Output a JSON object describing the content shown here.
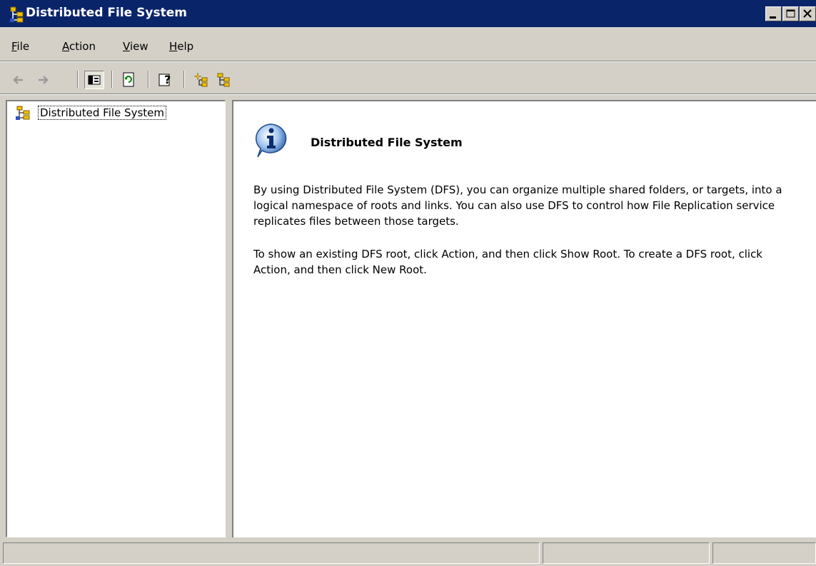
{
  "window": {
    "title": "Distributed File System",
    "icon": "dfs-icon",
    "controls": [
      "minimize-icon",
      "maximize-icon",
      "close-icon"
    ]
  },
  "menu": {
    "file": {
      "label": "File",
      "mnemonic": "F",
      "rest": "ile"
    },
    "action": {
      "label": "Action",
      "mnemonic": "A",
      "rest": "ction"
    },
    "view": {
      "label": "View",
      "mnemonic": "V",
      "rest": "iew"
    },
    "help": {
      "label": "Help",
      "mnemonic": "H",
      "rest": "elp"
    }
  },
  "toolbar": {
    "buttons": [
      "back-icon",
      "forward-icon",
      "show-hide-tree-icon",
      "refresh-icon",
      "help-icon",
      "new-root-icon",
      "show-root-icon"
    ]
  },
  "tree": {
    "root_label": "Distributed File System"
  },
  "content": {
    "heading": "Distributed File System",
    "para1": "By using Distributed File System (DFS), you can organize multiple shared folders, or targets, into a logical namespace of roots and links. You can also use DFS to control how File Replication service replicates files between those targets.",
    "para2": "To show an existing DFS root, click Action, and then click Show Root. To create a DFS root, click Action, and then click New Root."
  },
  "colors": {
    "titlebar": "#0a246a",
    "chrome": "#d4d0c8",
    "selection_outline": "#000000"
  }
}
